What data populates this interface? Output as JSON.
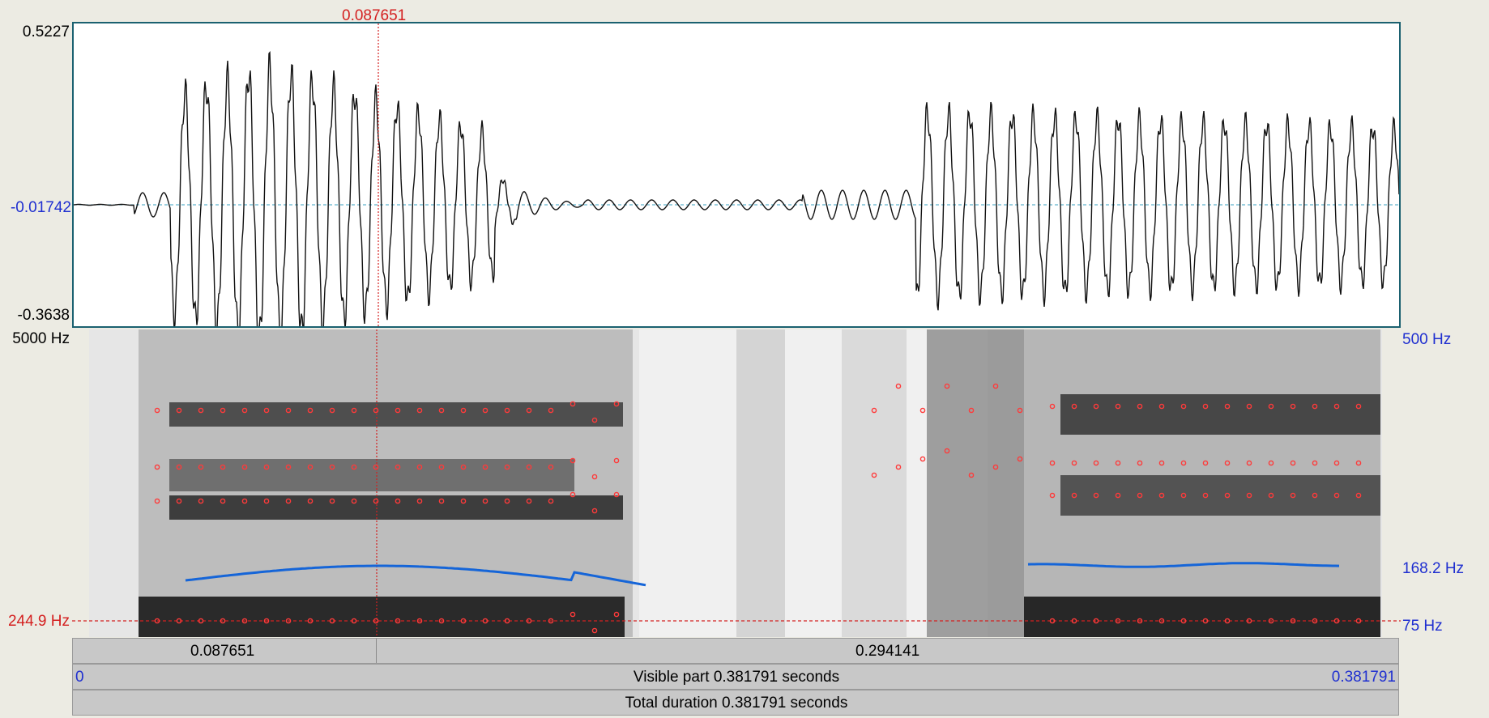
{
  "waveform": {
    "y_max_label": "0.5227",
    "y_mid_label": "-0.01742",
    "y_min_label": "-0.3638",
    "cursor_time_label": "0.087651"
  },
  "spectrogram": {
    "freq_max_label": "5000 Hz",
    "cursor_freq_label": "244.9 Hz",
    "pitch_top_label": "500 Hz",
    "pitch_value_label": "168.2 Hz",
    "pitch_bottom_label": "75 Hz"
  },
  "bars": {
    "cursor_left": "0.087651",
    "cursor_right": "0.294141",
    "visible_start": "0",
    "visible_text": "Visible part 0.381791 seconds",
    "visible_end": "0.381791",
    "total_text": "Total duration 0.381791 seconds"
  },
  "colors": {
    "cursor": "#d42020",
    "pitch": "#1565d8",
    "formant": "#e8202a",
    "frame": "#1b6170"
  }
}
